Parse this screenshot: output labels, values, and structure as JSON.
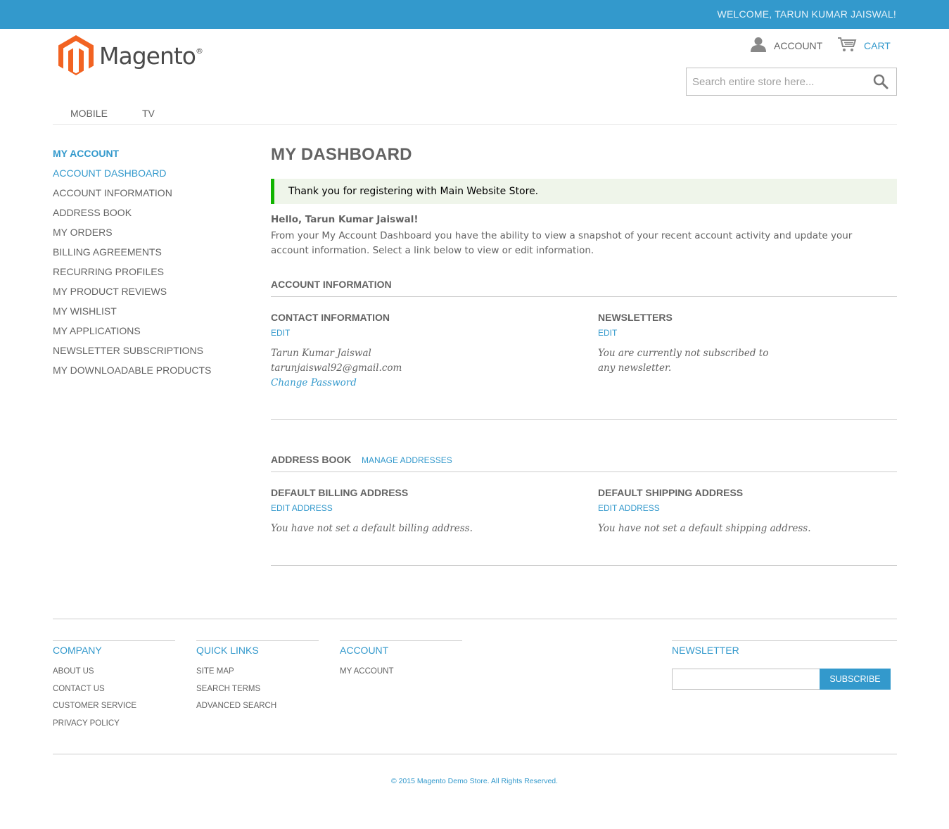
{
  "header": {
    "welcome": "WELCOME, TARUN KUMAR JAISWAL!",
    "logo_text": "Magento",
    "logo_mark": "®",
    "account_label": "ACCOUNT",
    "cart_label": "CART",
    "search_placeholder": "Search entire store here...",
    "search_icon": "search-icon",
    "account_icon": "user-icon",
    "cart_icon": "cart-icon"
  },
  "nav": {
    "items": [
      {
        "label": "MOBILE"
      },
      {
        "label": "TV"
      }
    ]
  },
  "sidebar": {
    "title": "MY ACCOUNT",
    "items": [
      {
        "label": "ACCOUNT DASHBOARD",
        "active": true
      },
      {
        "label": "ACCOUNT INFORMATION"
      },
      {
        "label": "ADDRESS BOOK"
      },
      {
        "label": "MY ORDERS"
      },
      {
        "label": "BILLING AGREEMENTS"
      },
      {
        "label": "RECURRING PROFILES"
      },
      {
        "label": "MY PRODUCT REVIEWS"
      },
      {
        "label": "MY WISHLIST"
      },
      {
        "label": "MY APPLICATIONS"
      },
      {
        "label": "NEWSLETTER SUBSCRIPTIONS"
      },
      {
        "label": "MY DOWNLOADABLE PRODUCTS"
      }
    ]
  },
  "main": {
    "title": "MY DASHBOARD",
    "success_message": "Thank you for registering with Main Website Store.",
    "hello": "Hello, Tarun Kumar Jaiswal!",
    "intro": "From your My Account Dashboard you have the ability to view a snapshot of your recent account activity and update your account information. Select a link below to view or edit information.",
    "account_info": {
      "title": "ACCOUNT INFORMATION",
      "contact": {
        "title": "CONTACT INFORMATION",
        "edit": "EDIT",
        "name": "Tarun Kumar Jaiswal",
        "email": "tarunjaiswal92@gmail.com",
        "change_password": "Change Password"
      },
      "newsletters": {
        "title": "NEWSLETTERS",
        "edit": "EDIT",
        "status": "You are currently not subscribed to any newsletter."
      }
    },
    "address_book": {
      "title": "ADDRESS BOOK",
      "manage": "MANAGE ADDRESSES",
      "billing": {
        "title": "DEFAULT BILLING ADDRESS",
        "edit": "EDIT ADDRESS",
        "status": "You have not set a default billing address."
      },
      "shipping": {
        "title": "DEFAULT SHIPPING ADDRESS",
        "edit": "EDIT ADDRESS",
        "status": "You have not set a default shipping address."
      }
    }
  },
  "footer": {
    "company": {
      "title": "COMPANY",
      "links": [
        "ABOUT US",
        "CONTACT US",
        "CUSTOMER SERVICE",
        "PRIVACY POLICY"
      ]
    },
    "quick_links": {
      "title": "QUICK LINKS",
      "links": [
        "SITE MAP",
        "SEARCH TERMS",
        "ADVANCED SEARCH"
      ]
    },
    "account": {
      "title": "ACCOUNT",
      "links": [
        "MY ACCOUNT"
      ]
    },
    "newsletter": {
      "title": "NEWSLETTER",
      "input_value": "",
      "subscribe": "SUBSCRIBE"
    },
    "copyright": "© 2015 Magento Demo Store. All Rights Reserved."
  },
  "colors": {
    "accent": "#3399cc",
    "text": "#636363",
    "success_bg": "#eff5ea",
    "success_border": "#11b400",
    "logo_orange": "#f26322"
  }
}
